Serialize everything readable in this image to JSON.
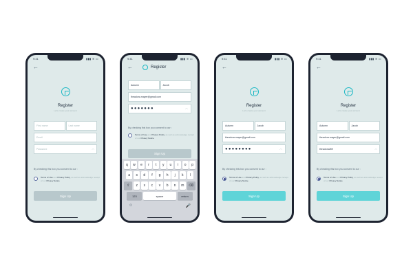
{
  "status": {
    "time": "9:41",
    "icons": "▮▮▮ ≋ ▭"
  },
  "back_icon": "←",
  "screens": [
    {
      "title": "Register",
      "subtitle": "Let's create your account",
      "first_name_placeholder": "First name",
      "last_name_placeholder": "Last name",
      "email_placeholder": "Email",
      "password_placeholder": "Password",
      "consent": "By checking this box you consent to our :",
      "terms_a": "Terms of Use",
      "terms_and": " and ",
      "terms_b": "Privacy Policy",
      "terms_rest": ", as well as acknowledge receipt of our ",
      "terms_c": "Privacy Notice",
      "button": "Sign Up"
    },
    {
      "title": "Register",
      "first_name": "Autumn",
      "last_name": "Jacob",
      "email": "theadora.mayer@gmail.com",
      "password": "●●●●●●●",
      "consent": "By checking this box you consent to our :",
      "terms_a": "Terms of Use",
      "terms_and": " and ",
      "terms_b": "Privacy Policy",
      "terms_rest": ", as well as acknowledge receipt of our ",
      "terms_c": "Privacy Notice",
      "button": "Sign Up",
      "keyboard": {
        "row1": [
          "q",
          "w",
          "e",
          "r",
          "t",
          "y",
          "u",
          "i",
          "o",
          "p"
        ],
        "row2": [
          "a",
          "s",
          "d",
          "f",
          "g",
          "h",
          "j",
          "k",
          "l"
        ],
        "row3": [
          "z",
          "x",
          "c",
          "v",
          "b",
          "n",
          "m"
        ],
        "shift": "⇧",
        "delete": "⌫",
        "k123": "123",
        "space": "space",
        "return": "return",
        "emoji": "☺",
        "mic": "🎤"
      }
    },
    {
      "title": "Register",
      "subtitle": "Let's create your account",
      "first_name": "Autumn",
      "last_name": "Jacob",
      "email": "theadora.mayer@gmail.com",
      "password": "●●●●●●●●",
      "consent": "By checking this box you consent to our :",
      "terms_a": "Terms of Use",
      "terms_and": " and ",
      "terms_b": "Privacy Policy",
      "terms_rest": ", as well as acknowledge receipt of our ",
      "terms_c": "Privacy Notice",
      "button": "Sign Up"
    },
    {
      "title": "Register",
      "subtitle": "Let's create your account",
      "first_name": "Autumn",
      "last_name": "Jacob",
      "email": "theadora.mayer@gmail.com",
      "password": "theadora289",
      "consent": "By checking this box you consent to our :",
      "terms_a": "Terms of Use",
      "terms_and": " and ",
      "terms_b": "Privacy Policy",
      "terms_rest": ", as well as acknowledge receipt of our ",
      "terms_c": "Privacy Notice",
      "button": "Sign Up"
    }
  ],
  "eye_icon": "◠",
  "colors": {
    "accent": "#5fd4d8",
    "logo": "#1ab8c4",
    "disabled": "#b8c8cc",
    "background": "#dfeaea"
  }
}
